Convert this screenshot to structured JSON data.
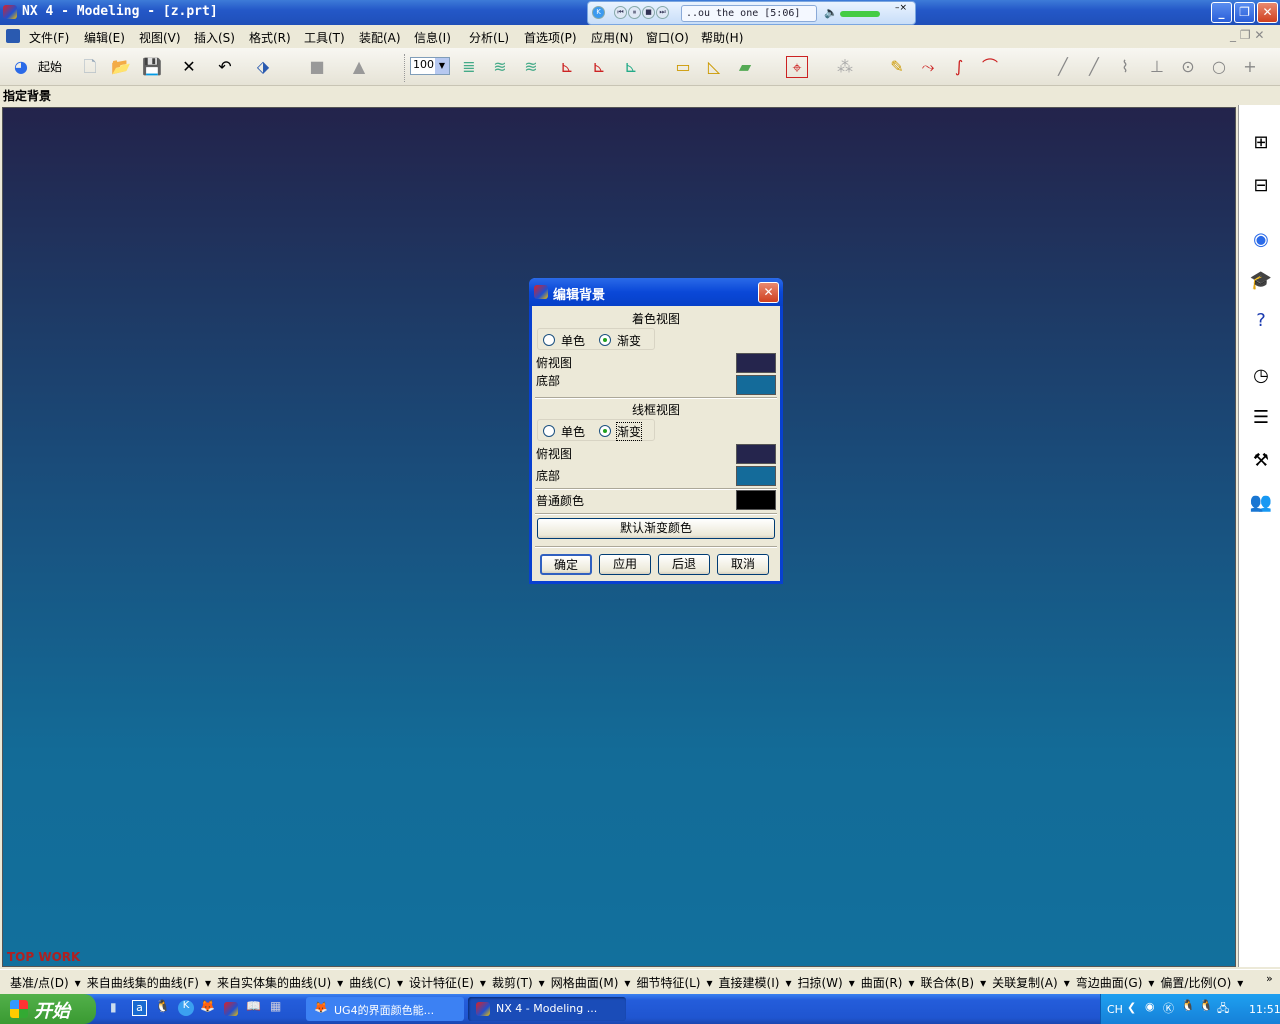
{
  "window": {
    "title": "NX 4 - Modeling - [z.prt]"
  },
  "player": {
    "track": "..ou the one [5:06]"
  },
  "menu": [
    "文件(F)",
    "编辑(E)",
    "视图(V)",
    "插入(S)",
    "格式(R)",
    "工具(T)",
    "装配(A)",
    "信息(I)",
    "分析(L)",
    "首选项(P)",
    "应用(N)",
    "窗口(O)",
    "帮助(H)"
  ],
  "toolbar": {
    "start_label": "起始",
    "zoom_value": "100"
  },
  "status": {
    "prompt": "指定背景"
  },
  "watermark": "TOP WORK",
  "dialog": {
    "title": "编辑背景",
    "shaded": {
      "heading": "着色视图",
      "single": "单色",
      "gradient": "渐变",
      "selected": "gradient",
      "top_label": "俯视图",
      "bottom_label": "底部",
      "top_color": "#25254d",
      "bottom_color": "#146b9a"
    },
    "wireframe": {
      "heading": "线框视图",
      "single": "单色",
      "gradient": "渐变",
      "selected": "gradient",
      "top_label": "俯视图",
      "bottom_label": "底部",
      "top_color": "#25254d",
      "bottom_color": "#146b9a"
    },
    "plain_label": "普通颜色",
    "plain_color": "#000000",
    "default_button": "默认渐变颜色",
    "ok": "确定",
    "apply": "应用",
    "back": "后退",
    "cancel": "取消"
  },
  "bottom_toolbar": [
    "基准/点(D)",
    "来自曲线集的曲线(F)",
    "来自实体集的曲线(U)",
    "曲线(C)",
    "设计特征(E)",
    "裁剪(T)",
    "网格曲面(M)",
    "细节特征(L)",
    "直接建模(I)",
    "扫掠(W)",
    "曲面(R)",
    "联合体(B)",
    "关联复制(A)",
    "弯边曲面(G)",
    "偏置/比例(O)"
  ],
  "taskbar": {
    "start": "开始",
    "tasks": [
      "UG4的界面颜色能...",
      "NX 4 - Modeling ..."
    ],
    "lang": "CH",
    "clock": "11:51"
  }
}
